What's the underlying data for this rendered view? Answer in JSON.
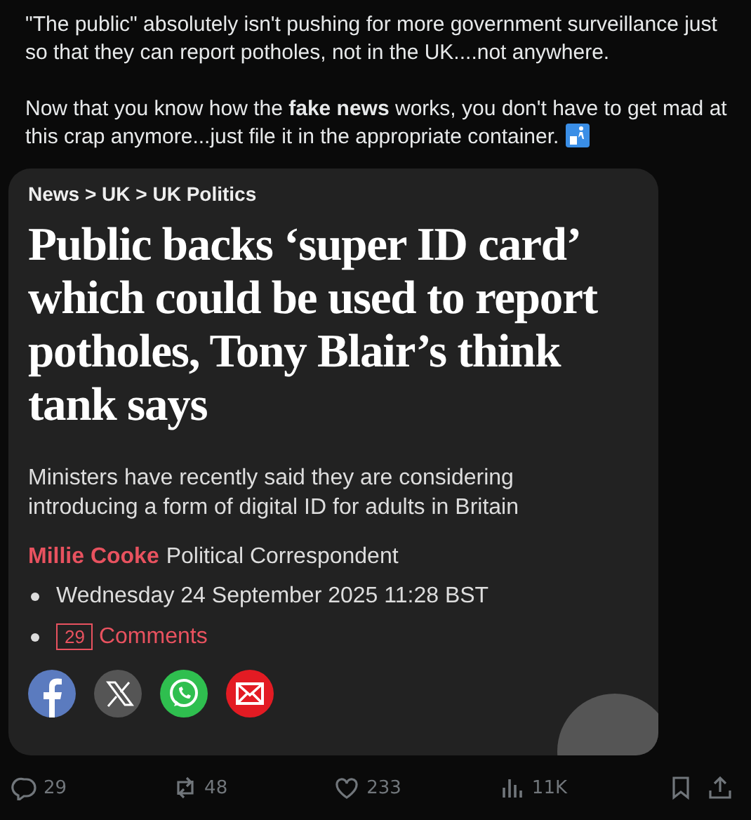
{
  "post": {
    "paragraphs": [
      "\"The public\" absolutely isn't pushing for more government surveillance just so that they can report potholes, not in the UK....not anywhere.",
      "Now that you know how the **fake news** works, you don't have to get mad at this crap anymore...just file it in the appropriate container."
    ]
  },
  "card": {
    "breadcrumb": "News > UK > UK Politics",
    "headline": "Public backs ‘super ID card’ which could be used to report potholes, Tony Blair’s think tank says",
    "standfirst": "Ministers have recently said they are considering introducing a form of digital ID for adults in Britain",
    "author": "Millie Cooke",
    "author_role": "Political Correspondent",
    "date": "Wednesday 24 September 2025 11:28 BST",
    "comment_count": "29",
    "comments_label": "Comments",
    "share": [
      {
        "kind": "facebook"
      },
      {
        "kind": "x"
      },
      {
        "kind": "whatsapp"
      },
      {
        "kind": "email"
      }
    ]
  },
  "actions": [
    {
      "kind": "reply",
      "count": "29"
    },
    {
      "kind": "repost",
      "count": "48"
    },
    {
      "kind": "like",
      "count": "233"
    },
    {
      "kind": "views",
      "count": "11K"
    },
    {
      "kind": "bookmark"
    },
    {
      "kind": "share"
    }
  ]
}
